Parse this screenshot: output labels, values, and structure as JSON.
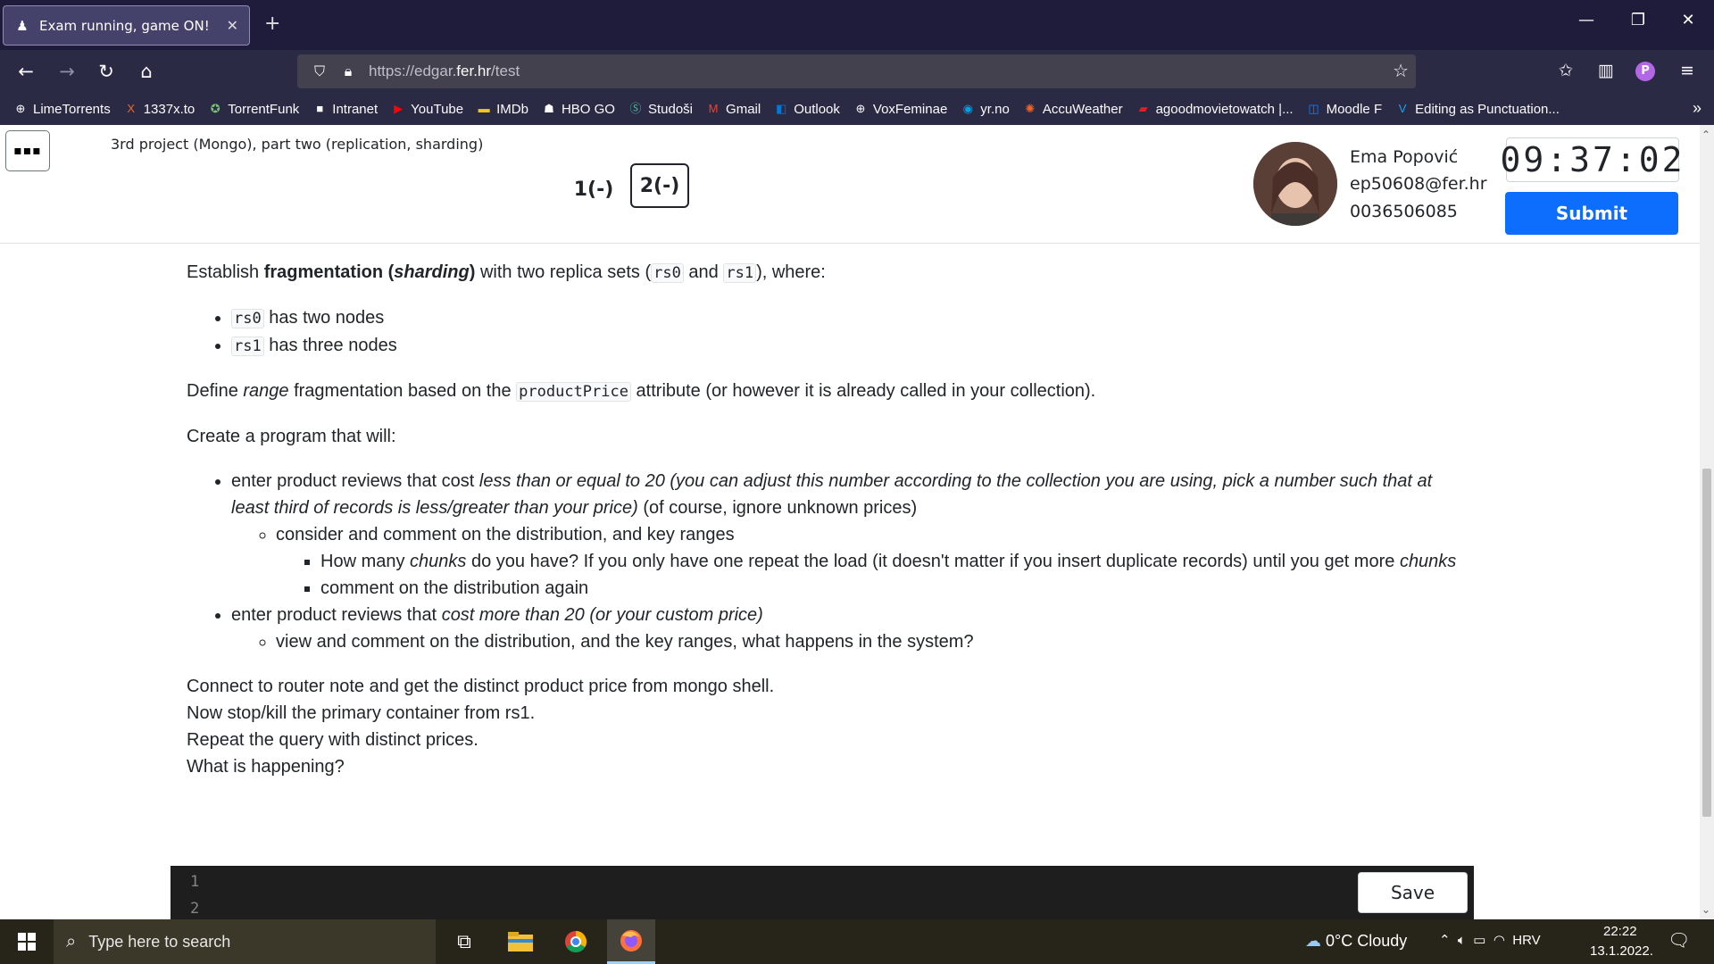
{
  "browser": {
    "tab_title": "Exam running, game ON!",
    "new_tab": "+",
    "tab_close": "✕",
    "url_prefix": "https://edgar.",
    "url_host": "fer.hr",
    "url_path": "/test",
    "bookmarks": [
      {
        "label": "LimeTorrents",
        "icon": "globe-icon",
        "color": "#fbfbfe"
      },
      {
        "label": "1337x.to",
        "icon": "x-icon",
        "color": "#f26522"
      },
      {
        "label": "TorrentFunk",
        "icon": "funk-icon",
        "color": "#7cc576"
      },
      {
        "label": "Intranet",
        "icon": "fer-icon",
        "color": "#fbfbfe"
      },
      {
        "label": "YouTube",
        "icon": "youtube-icon",
        "color": "#ff0000"
      },
      {
        "label": "IMDb",
        "icon": "imdb-icon",
        "color": "#f5c518"
      },
      {
        "label": "HBO GO",
        "icon": "hbo-icon",
        "color": "#fbfbfe"
      },
      {
        "label": "Studoši",
        "icon": "studosi-icon",
        "color": "#4fbf9f"
      },
      {
        "label": "Gmail",
        "icon": "gmail-icon",
        "color": "#ea4335"
      },
      {
        "label": "Outlook",
        "icon": "outlook-icon",
        "color": "#0078d4"
      },
      {
        "label": "VoxFeminae",
        "icon": "globe-icon",
        "color": "#fbfbfe"
      },
      {
        "label": "yr.no",
        "icon": "yr-icon",
        "color": "#00a0e4"
      },
      {
        "label": "AccuWeather",
        "icon": "sun-icon",
        "color": "#f26522"
      },
      {
        "label": "agoodmovietowatch |...",
        "icon": "flag-icon",
        "color": "#e02020"
      },
      {
        "label": "Moodle F",
        "icon": "moodle-icon",
        "color": "#0a84ff"
      },
      {
        "label": "Editing as Punctuation...",
        "icon": "v-icon",
        "color": "#1da1f2"
      }
    ]
  },
  "header": {
    "exam_title": "3rd project (Mongo), part two (replication, sharding)",
    "q1_label": "1(-)",
    "q2_label": "2(-)",
    "student_name": "Ema Popović",
    "student_email": "ep50608@fer.hr",
    "student_id": "0036506085",
    "timer": "09:37:02",
    "submit_label": "Submit"
  },
  "content": {
    "p1_pre": "Establish ",
    "p1_bold": "fragmentation (",
    "p1_bold_italic": "sharding",
    "p1_bold_close": ")",
    "p1_mid": " with two replica sets (",
    "code_rs0": "rs0",
    "p1_and": " and ",
    "code_rs1": "rs1",
    "p1_end": "), where:",
    "rs0_text": " has two nodes",
    "rs1_text": " has three nodes",
    "p2_pre": "Define ",
    "p2_italic": "range",
    "p2_mid": " fragmentation based on the ",
    "code_productPrice": "productPrice",
    "p2_end": " attribute (or however it is already called in your collection).",
    "p3": "Create a program that will:",
    "b1_pre": "enter product reviews that cost ",
    "b1_italic": "less than or equal to 20 (you can adjust this number according to the collection you are using, pick a number such that at least third of records is less/greater than your price)",
    "b1_end": " (of course, ignore unknown prices)",
    "b1_sub": "consider and comment on the distribution, and key ranges",
    "b1_subsub1_pre": "How many ",
    "b1_subsub1_italic": "chunks",
    "b1_subsub1_end": " do you have? If you only have one repeat the load (it doesn't matter if you insert duplicate records) until you get more ",
    "b1_subsub1_italic2": "chunks",
    "b1_subsub2": "comment on the distribution again",
    "b2_pre": "enter product reviews that ",
    "b2_italic": "cost more than 20 (or your custom price)",
    "b2_sub": "view and comment on the distribution, and the key ranges, what happens in the system?",
    "line1": "Connect to router note and get the distinct product price from mongo shell.",
    "line2": "Now stop/kill the primary container from rs1.",
    "line3": "Repeat the query with distinct prices.",
    "line4": "What is happening?"
  },
  "editor": {
    "line_numbers": [
      "1",
      "2"
    ],
    "save_label": "Save"
  },
  "taskbar": {
    "search_placeholder": "Type here to search",
    "weather": "0°C  Cloudy",
    "language": "HRV",
    "time": "22:22",
    "date": "13.1.2022."
  }
}
